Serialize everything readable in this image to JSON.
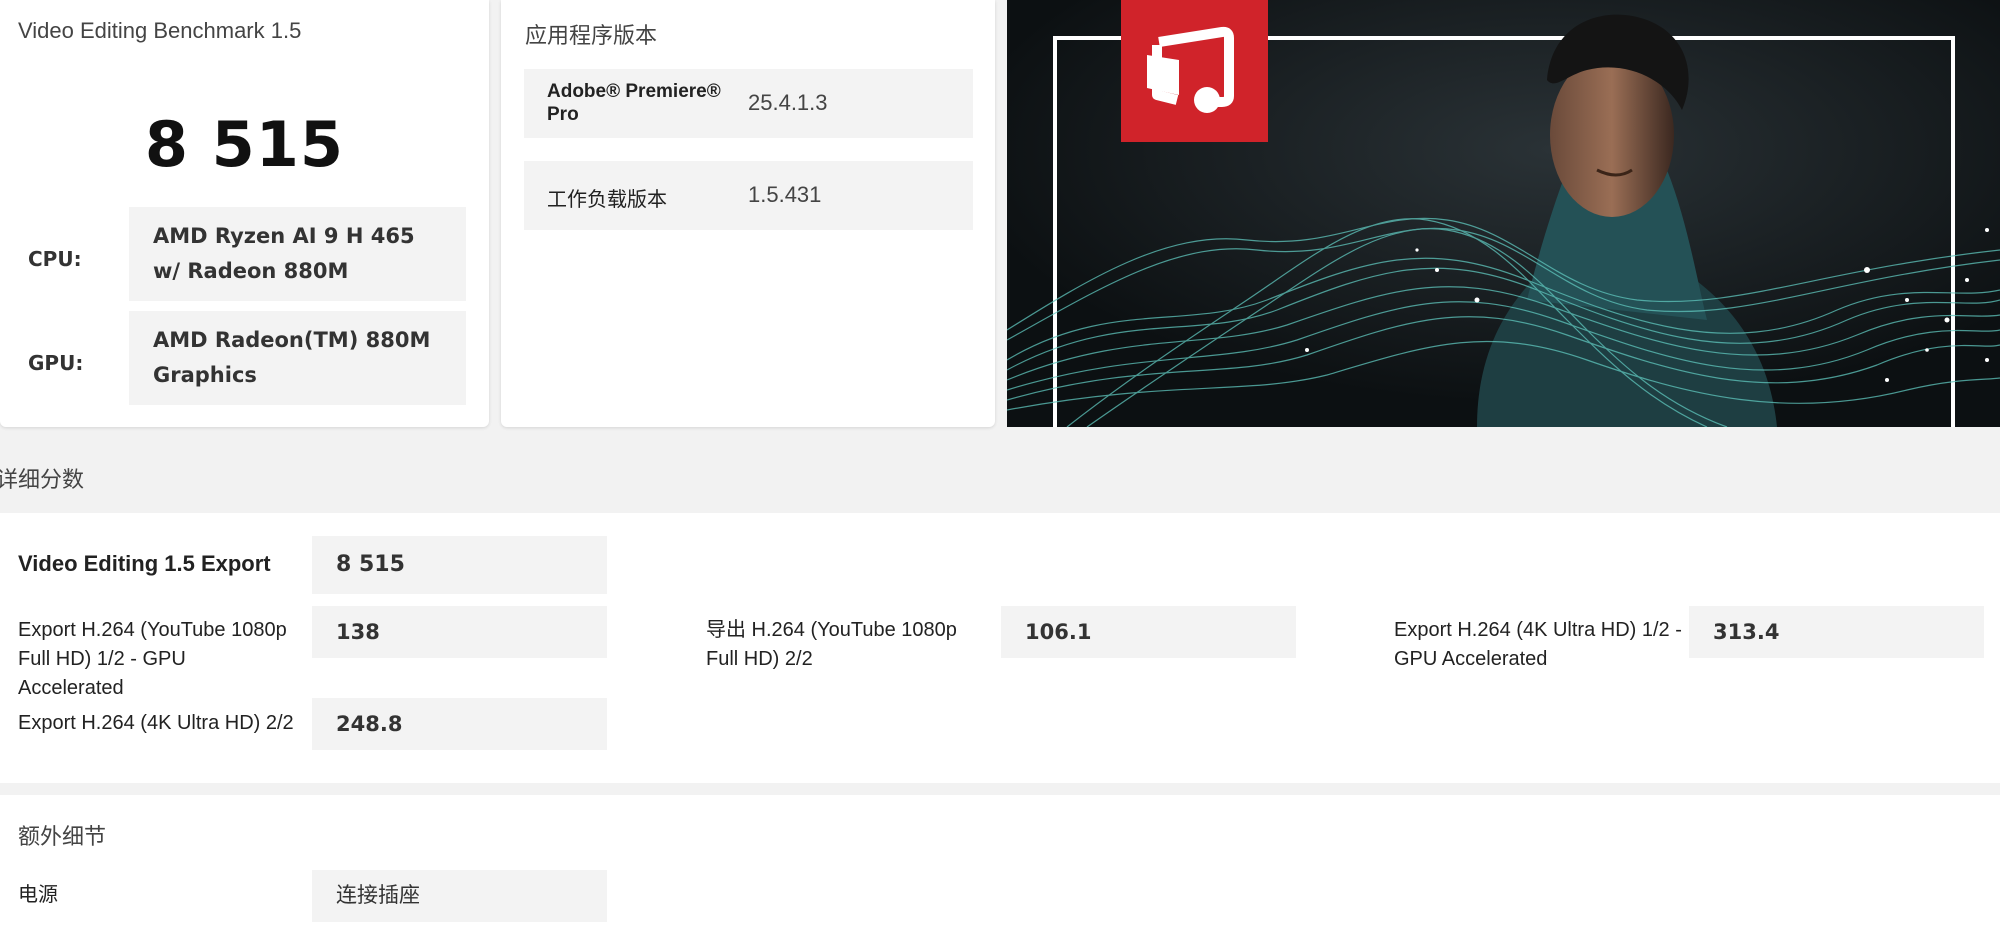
{
  "benchmark": {
    "title": "Video Editing Benchmark 1.5",
    "score": "8 515",
    "cpu_label": "CPU:",
    "cpu_value": "AMD Ryzen AI 9 H 465 w/ Radeon 880M",
    "gpu_label": "GPU:",
    "gpu_value": "AMD Radeon(TM) 880M Graphics"
  },
  "versions": {
    "title": "应用程序版本",
    "rows": [
      {
        "key": "Adobe® Premiere® Pro",
        "value": "25.4.1.3"
      },
      {
        "key": "工作负载版本",
        "value": "1.5.431"
      }
    ]
  },
  "details": {
    "title": "详细分数",
    "overall": {
      "label": "Video Editing 1.5 Export",
      "value": "8 515"
    },
    "metrics": [
      {
        "label": "Export H.264 (YouTube 1080p Full HD) 1/2 - GPU Accelerated",
        "value": "138"
      },
      {
        "label": "导出 H.264 (YouTube 1080p Full HD) 2/2",
        "value": "106.1"
      },
      {
        "label": "Export H.264 (4K Ultra HD) 1/2 - GPU Accelerated",
        "value": "313.4"
      },
      {
        "label": "Export H.264 (4K Ultra HD) 2/2",
        "value": "248.8"
      }
    ]
  },
  "extra": {
    "title": "额外细节",
    "power_label": "电源",
    "power_value": "连接插座"
  },
  "colors": {
    "accent_red": "#d0232a",
    "wave": "#5fc6bd",
    "hero_bg": "#0f1416"
  },
  "icons": {
    "app_logo": "presentation-screen-icon"
  }
}
